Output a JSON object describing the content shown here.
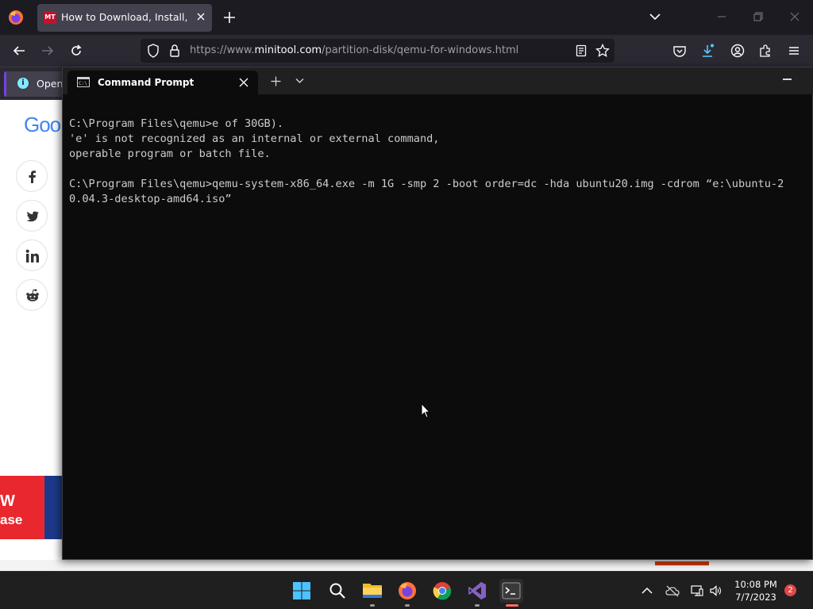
{
  "browser": {
    "tab": {
      "favicon_text": "MT",
      "title": "How to Download, Install, and U"
    },
    "url": {
      "prefix": "https://www.",
      "domain": "minitool.com",
      "path": "/partition-disk/qemu-for-windows.html"
    },
    "notice": {
      "text": "Open p"
    }
  },
  "webpage": {
    "logo_text": "Goo",
    "promo_text_1": "W",
    "promo_text_2": "ase",
    "share_icons": [
      "facebook-icon",
      "twitter-icon",
      "linkedin-icon",
      "reddit-icon"
    ]
  },
  "terminal": {
    "tab_title": "Command Prompt",
    "lines": [
      "C:\\Program Files\\qemu>e of 30GB).",
      "'e' is not recognized as an internal or external command,",
      "operable program or batch file.",
      "",
      "C:\\Program Files\\qemu>qemu-system-x86_64.exe -m 1G -smp 2 -boot order=dc -hda ubuntu20.img -cdrom “e:\\ubuntu-2",
      "0.04.3-desktop-amd64.iso”"
    ]
  },
  "taskbar": {
    "icons": [
      "windows-start-icon",
      "search-icon",
      "file-explorer-icon",
      "firefox-icon",
      "chrome-icon",
      "visual-studio-icon",
      "terminal-icon"
    ],
    "time": "10:08 PM",
    "date": "7/7/2023",
    "notification_count": "2"
  },
  "colors": {
    "terminal_bg": "#0c0c0c",
    "terminal_text": "#cccccc",
    "firefox_bg": "#1c1b22",
    "taskbar_bg": "#1f1f1f"
  }
}
